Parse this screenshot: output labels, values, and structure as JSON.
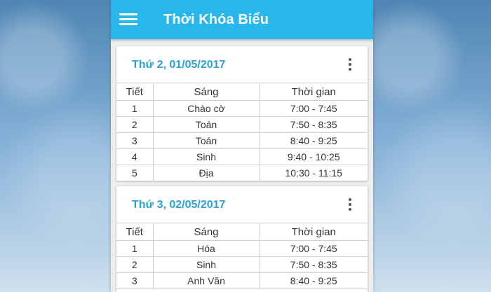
{
  "app": {
    "title": "Thời Khóa Biểu"
  },
  "days": [
    {
      "date": "Thứ 2, 01/05/2017",
      "headers": [
        "Tiết",
        "Sáng",
        "Thời gian"
      ],
      "rows": [
        [
          "1",
          "Chào cờ",
          "7:00 - 7:45"
        ],
        [
          "2",
          "Toán",
          "7:50 - 8:35"
        ],
        [
          "3",
          "Toán",
          "8:40 - 9:25"
        ],
        [
          "4",
          "Sinh",
          "9:40 - 10:25"
        ],
        [
          "5",
          "Địa",
          "10:30 - 11:15"
        ]
      ]
    },
    {
      "date": "Thứ 3, 02/05/2017",
      "headers": [
        "Tiết",
        "Sáng",
        "Thời gian"
      ],
      "rows": [
        [
          "1",
          "Hóa",
          "7:00 - 7:45"
        ],
        [
          "2",
          "Sinh",
          "7:50 - 8:35"
        ],
        [
          "3",
          "Anh Văn",
          "8:40 - 9:25"
        ]
      ]
    }
  ],
  "icons": {
    "menu": "hamburger-menu-icon",
    "more": "more-vert-icon"
  },
  "colors": {
    "appbar": "#29b6e8",
    "date": "#29a3d6"
  }
}
